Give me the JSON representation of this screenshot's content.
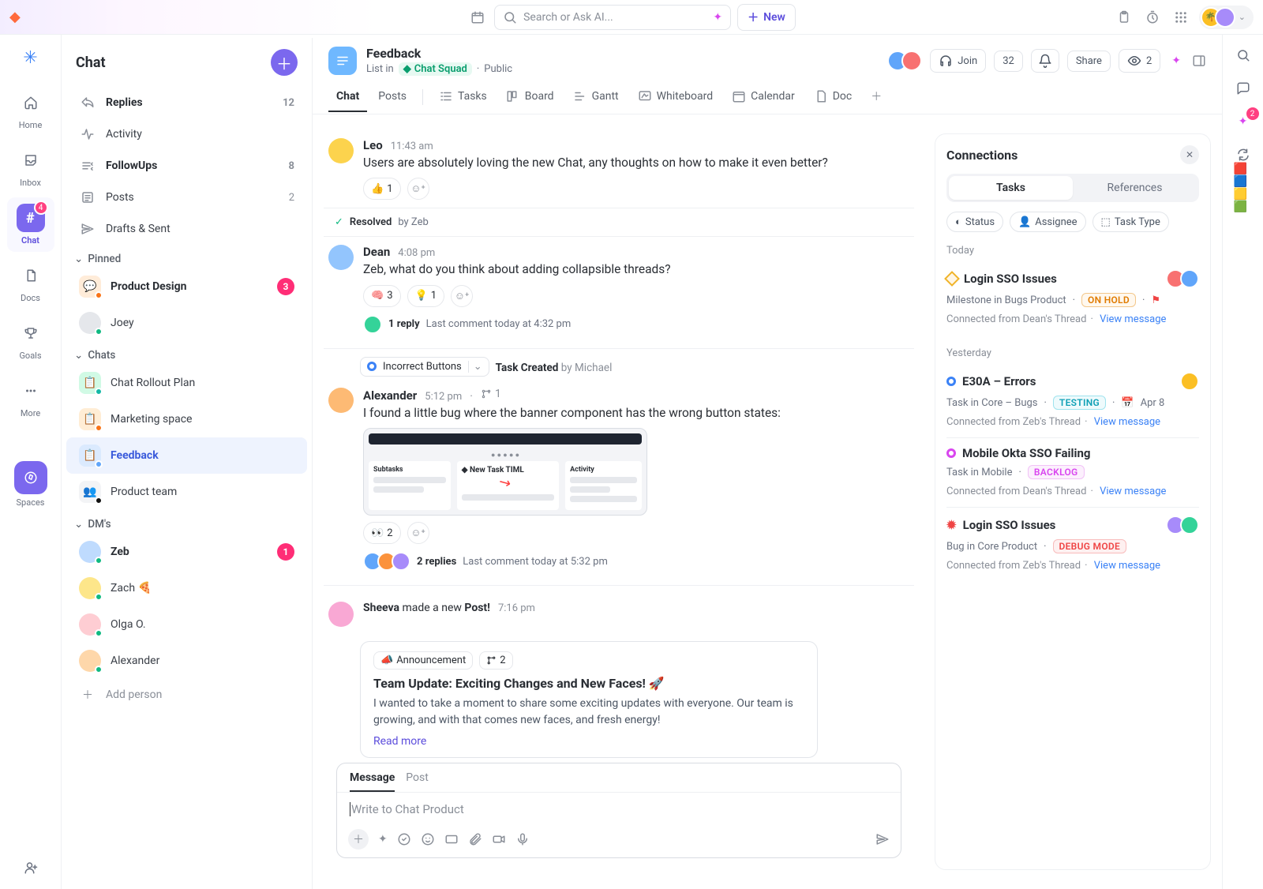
{
  "topbar": {
    "search_placeholder": "Search or Ask AI...",
    "new_label": "New"
  },
  "nav": {
    "home": "Home",
    "inbox": "Inbox",
    "chat": "Chat",
    "chat_badge": "4",
    "docs": "Docs",
    "goals": "Goals",
    "more": "More",
    "spaces": "Spaces"
  },
  "sidebar": {
    "title": "Chat",
    "replies": {
      "label": "Replies",
      "count": "12"
    },
    "activity": {
      "label": "Activity"
    },
    "followups": {
      "label": "FollowUps",
      "count": "8"
    },
    "posts": {
      "label": "Posts",
      "count": "2"
    },
    "drafts": {
      "label": "Drafts & Sent"
    },
    "pinned_label": "Pinned",
    "pinned": [
      {
        "label": "Product Design",
        "badge": "3",
        "color": "#ff8a00"
      },
      {
        "label": "Joey",
        "color": "#d1d5db"
      }
    ],
    "chats_label": "Chats",
    "chats": [
      {
        "label": "Chat Rollout Plan",
        "color": "#14b8a6"
      },
      {
        "label": "Marketing space",
        "color": "#f97316"
      },
      {
        "label": "Feedback",
        "color": "#60a5fa",
        "selected": true
      },
      {
        "label": "Product team",
        "color": "#9ca3af"
      }
    ],
    "dms_label": "DM's",
    "dms": [
      {
        "label": "Zeb",
        "badge": "1",
        "bold": true
      },
      {
        "label": "Zach 🍕"
      },
      {
        "label": "Olga O."
      },
      {
        "label": "Alexander"
      }
    ],
    "add_person": "Add person"
  },
  "channel": {
    "title": "Feedback",
    "list_in": "List in",
    "squad": "Chat Squad",
    "visibility": "Public",
    "join": "Join",
    "count": "32",
    "share": "Share",
    "watchers": "2",
    "tabs": {
      "chat": "Chat",
      "posts": "Posts",
      "tasks": "Tasks",
      "board": "Board",
      "gantt": "Gantt",
      "whiteboard": "Whiteboard",
      "calendar": "Calendar",
      "doc": "Doc"
    }
  },
  "messages": {
    "m1": {
      "author": "Leo",
      "time": "11:43 am",
      "text": "Users are absolutely loving the new Chat, any thoughts on how to make it even better?",
      "reaction_emoji": "👍",
      "reaction_count": "1"
    },
    "resolved": {
      "label": "Resolved",
      "by": "by Zeb"
    },
    "m2": {
      "author": "Dean",
      "time": "4:08 pm",
      "text": "Zeb, what do you think about adding collapsible threads?",
      "r1_emoji": "🧠",
      "r1_count": "3",
      "r2_emoji": "💡",
      "r2_count": "1",
      "replies": "1 reply",
      "last": "Last comment today at 4:32 pm"
    },
    "task": {
      "label": "Incorrect Buttons",
      "created_label": "Task Created",
      "by": "by Michael"
    },
    "m3": {
      "author": "Alexander",
      "time": "5:12 pm",
      "branches": "1",
      "text": "I found a little bug where the banner component has the wrong button states:",
      "r1_emoji": "👀",
      "r1_count": "2",
      "replies": "2 replies",
      "last": "Last comment today at 5:32 pm"
    },
    "m4": {
      "author": "Sheeva",
      "verb": "made a new",
      "noun": "Post!",
      "time": "7:16 pm",
      "tag1": "Announcement",
      "tag2": "2",
      "title": "Team Update: Exciting Changes and New Faces! 🚀",
      "body": "I wanted to take a moment to share some exciting updates with everyone. Our team is growing, and with that comes new faces, and fresh energy!",
      "read_more": "Read more"
    }
  },
  "composer": {
    "message_tab": "Message",
    "post_tab": "Post",
    "placeholder": "Write to Chat Product"
  },
  "connections": {
    "title": "Connections",
    "tabs": {
      "tasks": "Tasks",
      "references": "References"
    },
    "filters": {
      "status": "Status",
      "assignee": "Assignee",
      "type": "Task Type"
    },
    "today": "Today",
    "yesterday": "Yesterday",
    "items": [
      {
        "title": "Login SSO Issues",
        "sub": "Milestone in Bugs Product",
        "status": "ON HOLD",
        "foot": "Connected from Dean's Thread",
        "link": "View message"
      },
      {
        "title": "E30A – Errors",
        "sub": "Task in Core – Bugs",
        "status": "TESTING",
        "date": "Apr 8",
        "foot": "Connected from Zeb's Thread",
        "link": "View message"
      },
      {
        "title": "Mobile Okta SSO Failing",
        "sub": "Task in Mobile",
        "status": "BACKLOG",
        "foot": "Connected from Dean's Thread",
        "link": "View message"
      },
      {
        "title": "Login SSO Issues",
        "sub": "Bug in Core Product",
        "status": "DEBUG MODE",
        "foot": "Connected from Zeb's Thread",
        "link": "View message"
      }
    ]
  },
  "right_rail": {
    "badge": "2"
  }
}
